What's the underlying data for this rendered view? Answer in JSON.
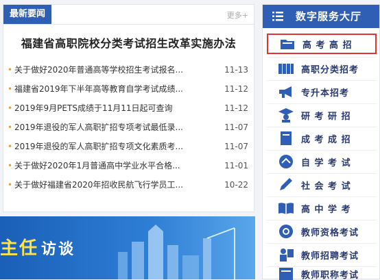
{
  "news": {
    "tab_label": "最新要闻",
    "more_label": "更多+",
    "headline": "福建省高职院校分类考试招生改革实施办法",
    "items": [
      {
        "title": "关于做好2020年普通高等学校招生考试报名...",
        "date": "11-13"
      },
      {
        "title": "福建省2019年下半年高等教育自学考试成绩...",
        "date": "11-12"
      },
      {
        "title": "2019年9月PETS成绩于11月11日起可查询",
        "date": "11-12"
      },
      {
        "title": "2019年退役的军人高职扩招专项考试最低录...",
        "date": "11-07"
      },
      {
        "title": "2019年退役的军人高职扩招专项文化素质考...",
        "date": "11-07"
      },
      {
        "title": "关于做好2020年1月普通高中学业水平合格...",
        "date": "11-01"
      },
      {
        "title": "关于做好福建省2020年招收民航飞行学员工...",
        "date": "10-22"
      }
    ]
  },
  "banner": {
    "text_a": "主任",
    "text_b": "访谈"
  },
  "sidebar": {
    "title": "数字服务大厅",
    "items": [
      {
        "label": "高 考 高 招",
        "icon": "folder-icon"
      },
      {
        "label": "高职分类招考",
        "icon": "books-icon"
      },
      {
        "label": "专升本招考",
        "icon": "megaphone-icon"
      },
      {
        "label": "研 考 研 招",
        "icon": "graduate-icon"
      },
      {
        "label": "成 考 成 招",
        "icon": "book-icon"
      },
      {
        "label": "自 学 考 试",
        "icon": "self-study-icon"
      },
      {
        "label": "社 会 考 试",
        "icon": "pen-icon"
      },
      {
        "label": "高 中 学 考",
        "icon": "open-book-icon"
      },
      {
        "label": "教师资格考试",
        "icon": "badge-icon"
      },
      {
        "label": "教师招聘考试",
        "icon": "teacher-icon"
      },
      {
        "label": "教师职称考试",
        "icon": "certificate-icon"
      }
    ]
  },
  "colors": {
    "primary": "#2f5fb4",
    "bullet": "#f0a228",
    "highlight": "#e23232"
  }
}
